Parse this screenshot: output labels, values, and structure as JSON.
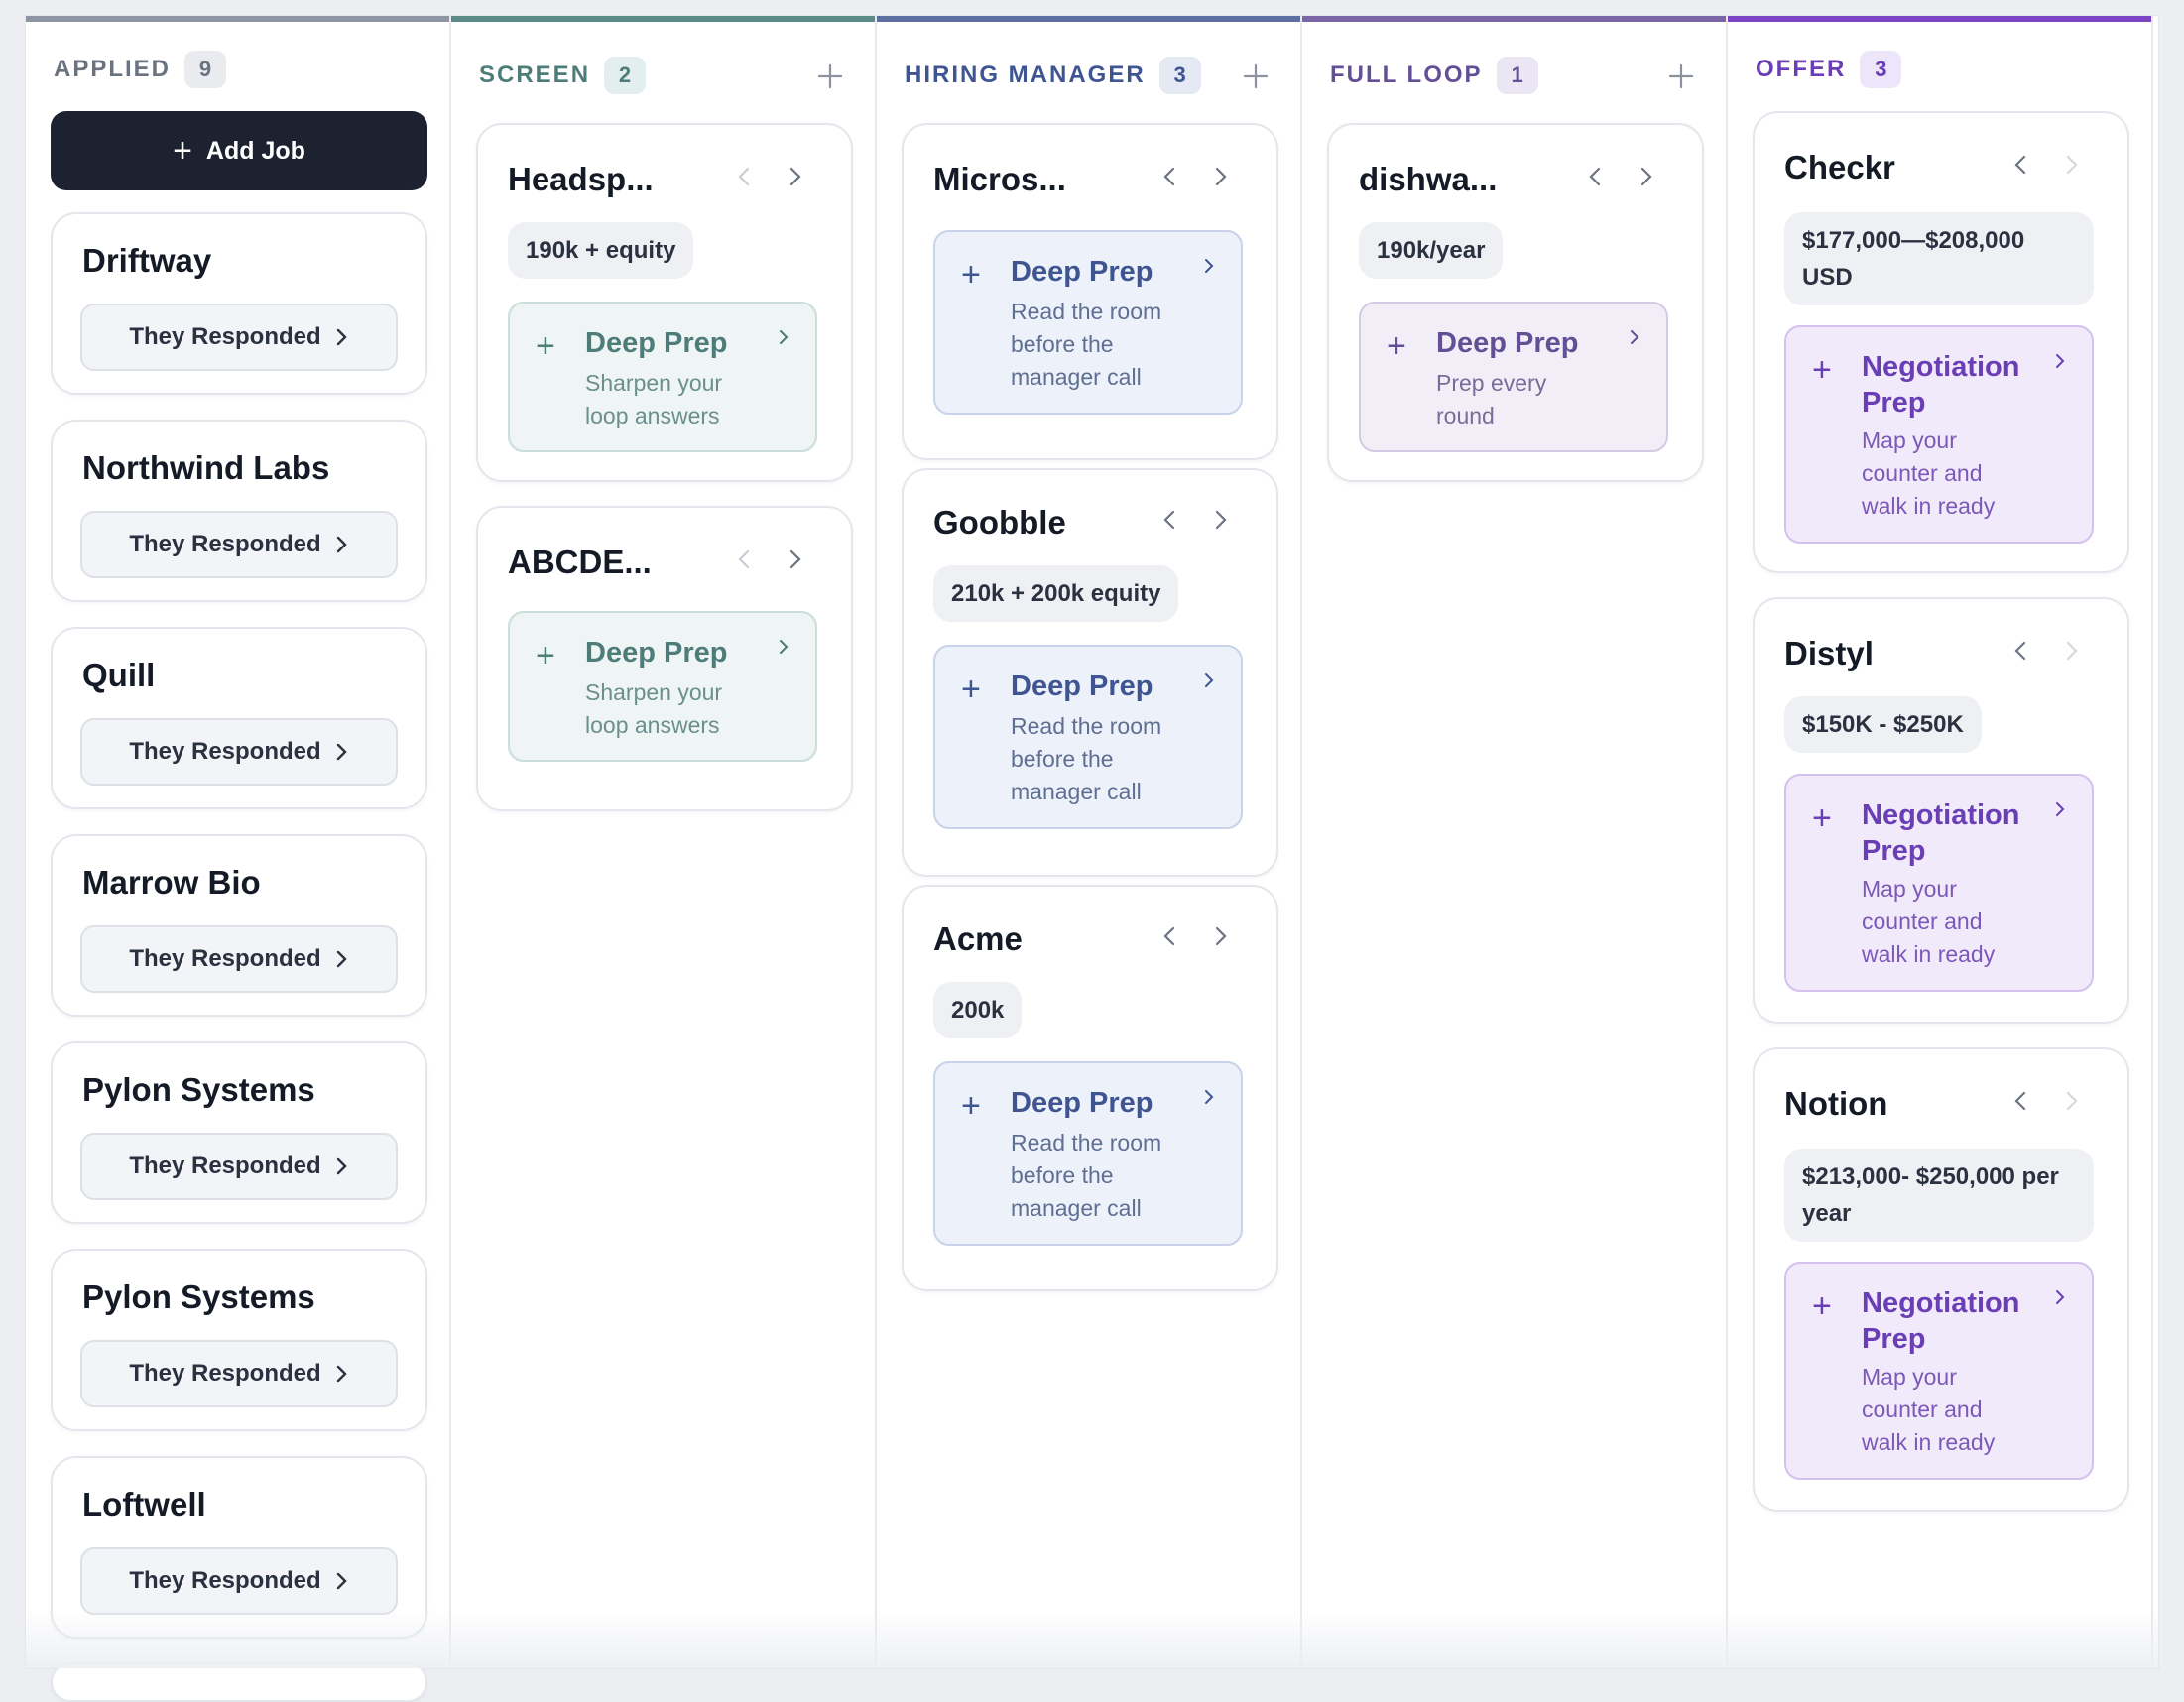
{
  "columns": [
    {
      "title": "APPLIED",
      "count": "9",
      "accent": "#8f96a3"
    },
    {
      "title": "SCREEN",
      "count": "2",
      "accent": "#5c8a88"
    },
    {
      "title": "HIRING MANAGER",
      "count": "3",
      "accent": "#5b6fa0"
    },
    {
      "title": "FULL LOOP",
      "count": "1",
      "accent": "#7a66a6"
    },
    {
      "title": "OFFER",
      "count": "3",
      "accent": "#7b45c4"
    }
  ],
  "applied": {
    "add_job_label": "Add Job",
    "cards": [
      {
        "company": "Driftway",
        "status": "They Responded"
      },
      {
        "company": "Northwind Labs",
        "status": "They Responded"
      },
      {
        "company": "Quill",
        "status": "They Responded"
      },
      {
        "company": "Marrow Bio",
        "status": "They Responded"
      },
      {
        "company": "Pylon Systems",
        "status": "They Responded"
      },
      {
        "company": "Pylon Systems",
        "status": "They Responded"
      },
      {
        "company": "Loftwell",
        "status": "They Responded"
      }
    ]
  },
  "screen": {
    "cards": [
      {
        "company": "Headsp...",
        "comp": "190k + equity",
        "prep_title": "Deep Prep",
        "prep_sub_lines": [
          "Sharpen your",
          "loop answers"
        ]
      },
      {
        "company": "ABCDE...",
        "prep_title": "Deep Prep",
        "prep_sub_lines": [
          "Sharpen your",
          "loop answers"
        ]
      }
    ]
  },
  "hiring_manager": {
    "cards": [
      {
        "company": "Micros...",
        "prep_title": "Deep Prep",
        "prep_sub_lines": [
          "Read the room",
          "before the",
          "manager call"
        ]
      },
      {
        "company": "Goobble",
        "comp": "210k + 200k equity",
        "prep_title": "Deep Prep",
        "prep_sub_lines": [
          "Read the room",
          "before the",
          "manager call"
        ]
      },
      {
        "company": "Acme",
        "comp": "200k",
        "prep_title": "Deep Prep",
        "prep_sub_lines": [
          "Read the room",
          "before the",
          "manager call"
        ]
      }
    ]
  },
  "full_loop": {
    "cards": [
      {
        "company": "dishwa...",
        "comp": "190k/year",
        "prep_title": "Deep Prep",
        "prep_sub_lines": [
          "Prep every",
          "round"
        ]
      }
    ]
  },
  "offer": {
    "cards": [
      {
        "company": "Checkr",
        "comp_lines": [
          "$177,000—$208,000",
          "USD"
        ],
        "prep_title_lines": [
          "Negotiation",
          "Prep"
        ],
        "prep_sub_lines": [
          "Map your",
          "counter and",
          "walk in ready"
        ]
      },
      {
        "company": "Distyl",
        "comp_lines": [
          "$150K - $250K"
        ],
        "prep_title_lines": [
          "Negotiation",
          "Prep"
        ],
        "prep_sub_lines": [
          "Map your",
          "counter and",
          "walk in ready"
        ]
      },
      {
        "company": "Notion",
        "comp_lines": [
          "$213,000- $250,000 per",
          "year"
        ],
        "prep_title_lines": [
          "Negotiation",
          "Prep"
        ],
        "prep_sub_lines": [
          "Map your",
          "counter and",
          "walk in ready"
        ]
      }
    ]
  },
  "theme": {
    "screen_prep_bg": "#eef5f4",
    "screen_prep_border": "#c9dedb",
    "screen_prep_fg": "#4d7c79",
    "screen_prep_sub": "#6a8f8c",
    "hm_prep_bg": "#edf1f9",
    "hm_prep_border": "#c8d2e8",
    "hm_prep_fg": "#3f5591",
    "hm_prep_sub": "#5f6f92",
    "fl_prep_bg": "#f1eef7",
    "fl_prep_border": "#d3cae4",
    "fl_prep_fg": "#634f96",
    "fl_prep_sub": "#7a6c97",
    "offer_prep_bg": "#f1eafb",
    "offer_prep_border": "#d3c1f0",
    "offer_prep_fg": "#6a3fb6",
    "offer_prep_sub": "#7c58b8"
  }
}
